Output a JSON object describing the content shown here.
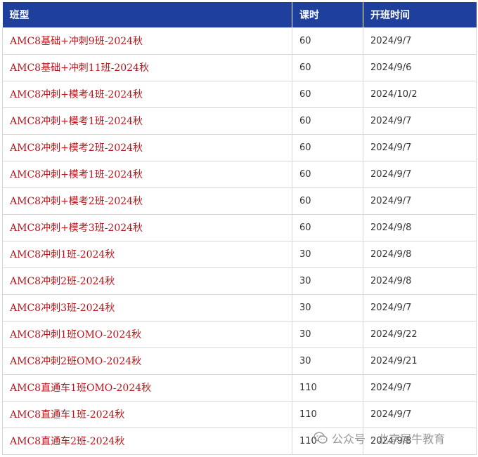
{
  "table": {
    "headers": {
      "name": "班型",
      "hours": "课时",
      "start": "开班时间"
    },
    "rows": [
      {
        "name": "AMC8基础+冲刺9班-2024秋",
        "hours": "60",
        "start": "2024/9/7"
      },
      {
        "name": "AMC8基础+冲刺11班-2024秋",
        "hours": "60",
        "start": "2024/9/6"
      },
      {
        "name": "AMC8冲刺+模考4班-2024秋",
        "hours": "60",
        "start": "2024/10/2"
      },
      {
        "name": "AMC8冲刺+模考1班-2024秋",
        "hours": "60",
        "start": "2024/9/7"
      },
      {
        "name": "AMC8冲刺+模考2班-2024秋",
        "hours": "60",
        "start": "2024/9/7"
      },
      {
        "name": "AMC8冲刺+模考1班-2024秋",
        "hours": "60",
        "start": "2024/9/7"
      },
      {
        "name": "AMC8冲刺+模考2班-2024秋",
        "hours": "60",
        "start": "2024/9/7"
      },
      {
        "name": "AMC8冲刺+模考3班-2024秋",
        "hours": "60",
        "start": "2024/9/8"
      },
      {
        "name": "AMC8冲刺1班-2024秋",
        "hours": "30",
        "start": "2024/9/8"
      },
      {
        "name": "AMC8冲刺2班-2024秋",
        "hours": "30",
        "start": "2024/9/8"
      },
      {
        "name": "AMC8冲刺3班-2024秋",
        "hours": "30",
        "start": "2024/9/7"
      },
      {
        "name": "AMC8冲刺1班OMO-2024秋",
        "hours": "30",
        "start": "2024/9/22"
      },
      {
        "name": "AMC8冲刺2班OMO-2024秋",
        "hours": "30",
        "start": "2024/9/21"
      },
      {
        "name": "AMC8直通车1班OMO-2024秋",
        "hours": "110",
        "start": "2024/9/7"
      },
      {
        "name": "AMC8直通车1班-2024秋",
        "hours": "110",
        "start": "2024/9/7"
      },
      {
        "name": "AMC8直通车2班-2024秋",
        "hours": "110",
        "start": "2024/9/8"
      }
    ]
  },
  "watermark": {
    "source": "公众号",
    "separator": "·",
    "account": "北京犀牛教育",
    "icon": "wechat-icon"
  },
  "colors": {
    "header_bg": "#1f3f9c",
    "link_red": "#b8141a",
    "border": "#d8d8d8"
  }
}
